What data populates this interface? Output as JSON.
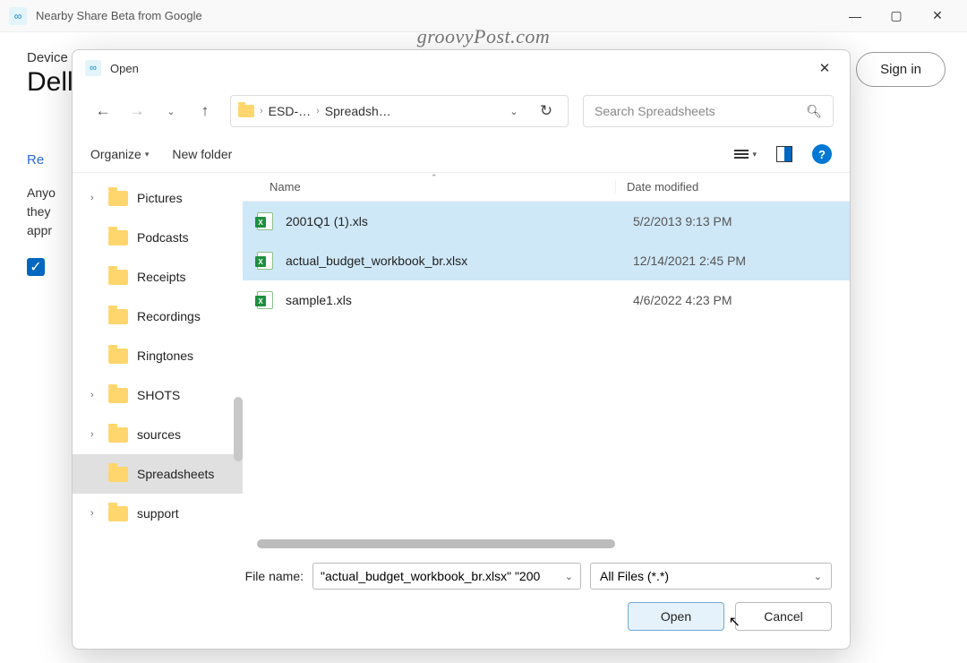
{
  "window": {
    "title": "Nearby Share Beta from Google",
    "watermark": "groovyPost.com"
  },
  "app": {
    "device_label": "Device",
    "device_name": "Dell-",
    "recent": "Re",
    "side_line1": "Anyo",
    "side_line2": "they",
    "side_line3": "appr",
    "signin": "Sign in"
  },
  "dialog": {
    "title": "Open",
    "breadcrumb": {
      "p1": "ESD-…",
      "p2": "Spreadsh…"
    },
    "search_placeholder": "Search Spreadsheets",
    "organize": "Organize",
    "new_folder": "New folder",
    "columns": {
      "name": "Name",
      "date": "Date modified"
    },
    "sidebar": [
      {
        "label": "Pictures",
        "expandable": true
      },
      {
        "label": "Podcasts",
        "expandable": false
      },
      {
        "label": "Receipts",
        "expandable": false
      },
      {
        "label": "Recordings",
        "expandable": false
      },
      {
        "label": "Ringtones",
        "expandable": false
      },
      {
        "label": "SHOTS",
        "expandable": true
      },
      {
        "label": "sources",
        "expandable": true
      },
      {
        "label": "Spreadsheets",
        "expandable": false,
        "selected": true
      },
      {
        "label": "support",
        "expandable": true
      }
    ],
    "files": [
      {
        "name": "2001Q1 (1).xls",
        "date": "5/2/2013 9:13 PM",
        "selected": true
      },
      {
        "name": "actual_budget_workbook_br.xlsx",
        "date": "12/14/2021 2:45 PM",
        "selected": true
      },
      {
        "name": "sample1.xls",
        "date": "4/6/2022 4:23 PM",
        "selected": false
      }
    ],
    "file_name_label": "File name:",
    "file_name_value": "\"actual_budget_workbook_br.xlsx\" \"200",
    "filter": "All Files (*.*)",
    "open_btn": "Open",
    "cancel_btn": "Cancel"
  }
}
